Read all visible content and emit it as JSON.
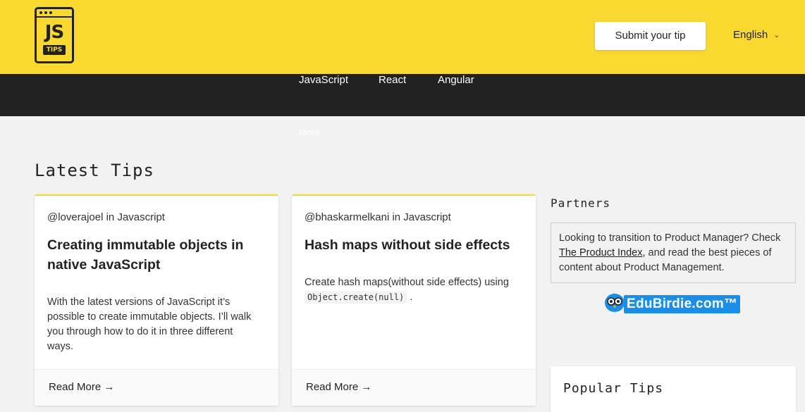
{
  "header": {
    "logo_js": "JS",
    "logo_tips": "TIPS",
    "submit_label": "Submit your tip",
    "language": "English",
    "colors": {
      "brand_yellow": "#f9d92f",
      "nav_dark": "#222222"
    }
  },
  "nav": {
    "items": [
      {
        "label": "JavaScript"
      },
      {
        "label": "React"
      },
      {
        "label": "Angular"
      }
    ],
    "more_label": "More"
  },
  "main": {
    "section_title": "Latest Tips",
    "cards": [
      {
        "author": "@loverajoel in Javascript",
        "title": "Creating immutable objects in native JavaScript",
        "body": "With the latest versions of JavaScript it’s possible to create immutable objects. I’ll walk you through how to do it in three different ways.",
        "read_more": "Read More →"
      },
      {
        "author": "@bhaskarmelkani in Javascript",
        "title": "Hash maps without side effects",
        "body_prefix": "Create hash maps(without side effects) using",
        "body_code": "Object.create(null)",
        "body_suffix": ".",
        "read_more": "Read More →"
      }
    ]
  },
  "sidebar": {
    "partners_title": "Partners",
    "partner_text_1": "Looking to transition to Product Manager? Check ",
    "partner_link": "The Product Index,",
    "partner_text_2": " and read the best pieces of content about Product Management.",
    "edubirdie_label": "EduBirdie.com™",
    "popular_title": "Popular Tips"
  }
}
